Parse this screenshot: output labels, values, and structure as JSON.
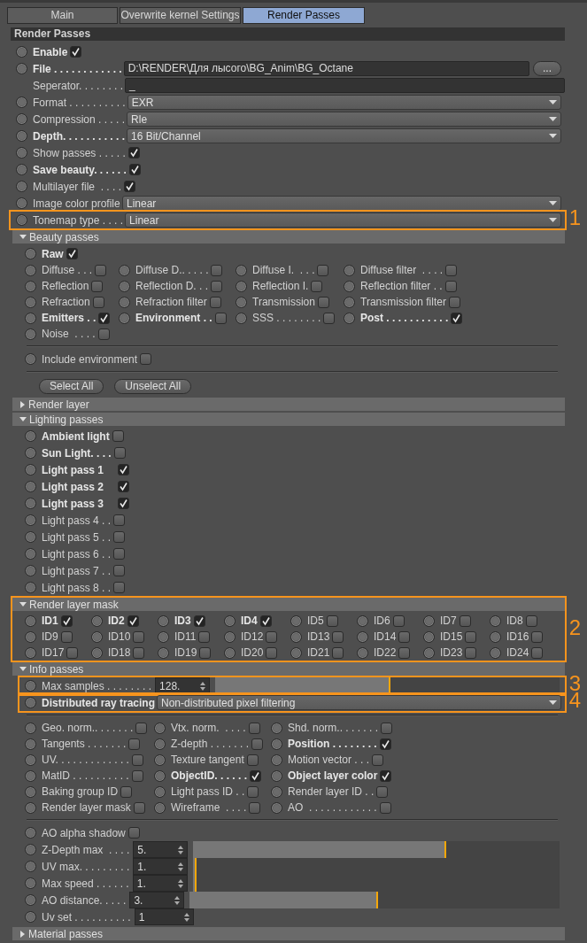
{
  "tabs": [
    {
      "label": "Main",
      "selected": false
    },
    {
      "label": "Overwrite kernel Settings",
      "selected": false
    },
    {
      "label": "Render Passes",
      "selected": true
    }
  ],
  "panel": {
    "title": "Render Passes",
    "rows": [
      {
        "kind": "check",
        "label": "Enable",
        "bold": true,
        "checked": true
      },
      {
        "kind": "path",
        "label": "File . . . . . . . . . . . .",
        "bold": true,
        "value": "D:\\RENDER\\Для лысого\\BG_Anim\\BG_Octane",
        "button": "..."
      },
      {
        "kind": "text",
        "label": "Seperator. . . . . . . .",
        "animatable": false,
        "value": "_"
      },
      {
        "kind": "dropdown",
        "label": "Format . . . . . . . . . .",
        "value": "EXR"
      },
      {
        "kind": "dropdown",
        "label": "Compression . . . . .",
        "value": "Rle"
      },
      {
        "kind": "dropdown",
        "label": "Depth. . . . . . . . . . .",
        "bold": true,
        "value": "16 Bit/Channel"
      },
      {
        "kind": "check",
        "label": "Show passes . . . . .",
        "checked": true
      },
      {
        "kind": "check",
        "label": "Save beauty. . . . . .",
        "bold": true,
        "checked": true
      },
      {
        "kind": "check",
        "label": "Multilayer file  . . . .",
        "checked": true
      },
      {
        "kind": "dropdown",
        "label": "Image color profile",
        "value": "Linear"
      },
      {
        "kind": "dropdown",
        "label": "Tonemap type . . . .",
        "value": "Linear",
        "annotation": "1"
      },
      {
        "kind": "group",
        "title": "Beauty passes",
        "expanded": true,
        "rows": [
          {
            "kind": "check",
            "label": "Raw",
            "bold": true,
            "checked": true
          },
          {
            "kind": "grid4",
            "items": [
              {
                "label": "Diffuse . . .",
                "checked": false
              },
              {
                "label": "Diffuse D.. . . . .",
                "checked": false
              },
              {
                "label": "Diffuse I.  . . .",
                "checked": false
              },
              {
                "label": "Diffuse filter  . . . .",
                "checked": false
              },
              {
                "label": "Reflection",
                "checked": false
              },
              {
                "label": "Reflection D. . .",
                "checked": false
              },
              {
                "label": "Reflection I.",
                "checked": false
              },
              {
                "label": "Reflection filter . .",
                "checked": false
              },
              {
                "label": "Refraction",
                "checked": false
              },
              {
                "label": "Refraction filter",
                "checked": false
              },
              {
                "label": "Transmission",
                "checked": false
              },
              {
                "label": "Transmission filter",
                "checked": false
              },
              {
                "label": "Emitters . .",
                "bold": true,
                "checked": true
              },
              {
                "label": "Environment . .",
                "bold": true,
                "checked": false
              },
              {
                "label": "SSS . . . . . . . .",
                "checked": false
              },
              {
                "label": "Post . . . . . . . . . . .",
                "bold": true,
                "checked": true
              },
              {
                "label": "Noise  . . . .",
                "checked": false
              }
            ]
          },
          {
            "kind": "divider"
          },
          {
            "kind": "check",
            "label": "Include environment",
            "checked": false
          },
          {
            "kind": "divider"
          },
          {
            "kind": "buttons",
            "buttons": [
              "Select All",
              "Unselect All"
            ]
          }
        ]
      },
      {
        "kind": "group",
        "title": "Render layer",
        "expanded": false
      },
      {
        "kind": "group",
        "title": "Lighting passes",
        "expanded": true,
        "rows": [
          {
            "kind": "check",
            "label": "Ambient light",
            "bold": true,
            "checked": false
          },
          {
            "kind": "check",
            "label": "Sun Light. . . .",
            "bold": true,
            "checked": false
          },
          {
            "kind": "check",
            "label": "Light pass 1    ",
            "bold": true,
            "checked": true
          },
          {
            "kind": "check",
            "label": "Light pass 2    ",
            "bold": true,
            "checked": true
          },
          {
            "kind": "check",
            "label": "Light pass 3    ",
            "bold": true,
            "checked": true
          },
          {
            "kind": "check",
            "label": "Light pass 4 . .",
            "checked": false
          },
          {
            "kind": "check",
            "label": "Light pass 5 . .",
            "checked": false
          },
          {
            "kind": "check",
            "label": "Light pass 6 . .",
            "checked": false
          },
          {
            "kind": "check",
            "label": "Light pass 7 . .",
            "checked": false
          },
          {
            "kind": "check",
            "label": "Light pass 8 . .",
            "checked": false
          }
        ]
      },
      {
        "kind": "group",
        "title": "Render layer mask",
        "expanded": true,
        "annotation": "2",
        "rows": [
          {
            "kind": "grid8",
            "items": [
              {
                "label": "ID1",
                "bold": true,
                "checked": true
              },
              {
                "label": "ID2",
                "bold": true,
                "checked": true
              },
              {
                "label": "ID3",
                "bold": true,
                "checked": true
              },
              {
                "label": "ID4",
                "bold": true,
                "checked": true
              },
              {
                "label": "ID5",
                "checked": false
              },
              {
                "label": "ID6",
                "checked": false
              },
              {
                "label": "ID7",
                "checked": false
              },
              {
                "label": "ID8",
                "checked": false
              },
              {
                "label": "ID9",
                "checked": false
              },
              {
                "label": "ID10",
                "checked": false
              },
              {
                "label": "ID11",
                "checked": false
              },
              {
                "label": "ID12",
                "checked": false
              },
              {
                "label": "ID13",
                "checked": false
              },
              {
                "label": "ID14",
                "checked": false
              },
              {
                "label": "ID15",
                "checked": false
              },
              {
                "label": "ID16",
                "checked": false
              },
              {
                "label": "ID17",
                "checked": false
              },
              {
                "label": "ID18",
                "checked": false
              },
              {
                "label": "ID19",
                "checked": false
              },
              {
                "label": "ID20",
                "checked": false
              },
              {
                "label": "ID21",
                "checked": false
              },
              {
                "label": "ID22",
                "checked": false
              },
              {
                "label": "ID23",
                "checked": false
              },
              {
                "label": "ID24",
                "checked": false
              }
            ]
          }
        ]
      },
      {
        "kind": "group",
        "title": "Info passes",
        "expanded": true,
        "rows": [
          {
            "kind": "slider",
            "label": "Max samples . . . . . . . .",
            "value": "128.",
            "level": 0.51,
            "annotation": "3"
          },
          {
            "kind": "dropdown",
            "label": "Distributed ray tracing",
            "bold": true,
            "value": "Non-distributed pixel filtering",
            "annotation": "4"
          },
          {
            "kind": "divider"
          },
          {
            "kind": "grid3",
            "items": [
              {
                "label": "Geo. norm.. . . . . . .",
                "checked": false
              },
              {
                "label": "Vtx. norm.  . . . .",
                "checked": false
              },
              {
                "label": "Shd. norm.. . . . . . .",
                "checked": false
              },
              {
                "label": "Tangents . . . . . . .",
                "checked": false
              },
              {
                "label": "Z-depth . . . . . . .",
                "checked": false
              },
              {
                "label": "Position . . . . . . . .",
                "bold": true,
                "checked": true
              },
              {
                "label": "UV. . . . . . . . . . . . .",
                "checked": false
              },
              {
                "label": "Texture tangent",
                "checked": false
              },
              {
                "label": "Motion vector . . .",
                "checked": false
              },
              {
                "label": "MatID . . . . . . . . . .",
                "checked": false
              },
              {
                "label": "ObjectID. . . . . .",
                "bold": true,
                "checked": true
              },
              {
                "label": "Object layer color",
                "bold": true,
                "checked": true
              },
              {
                "label": "Baking group ID",
                "checked": false
              },
              {
                "label": "Light pass ID . .",
                "checked": false
              },
              {
                "label": "Render layer ID . .",
                "checked": false
              },
              {
                "label": "Render layer mask",
                "checked": false
              },
              {
                "label": "Wireframe  . . . .",
                "checked": false
              },
              {
                "label": "AO  . . . . . . . . . . . .",
                "checked": false
              }
            ]
          },
          {
            "kind": "divider"
          },
          {
            "kind": "check",
            "label": "AO alpha shadow",
            "checked": false
          },
          {
            "kind": "slider",
            "label": "Z-Depth max  . . . .",
            "value": "5.",
            "level": 0.69
          },
          {
            "kind": "slider",
            "label": "UV max. . . . . . . . .",
            "value": "1.",
            "level": 0.01
          },
          {
            "kind": "slider",
            "label": "Max speed . . . . . .",
            "value": "1.",
            "level": 0.01
          },
          {
            "kind": "slider",
            "label": "AO distance. . . . .",
            "value": "3.",
            "level": 0.51
          },
          {
            "kind": "spinner",
            "label": "Uv set . . . . . . . . . .",
            "value": "1"
          }
        ]
      },
      {
        "kind": "group",
        "title": "Material passes",
        "expanded": false
      }
    ]
  }
}
